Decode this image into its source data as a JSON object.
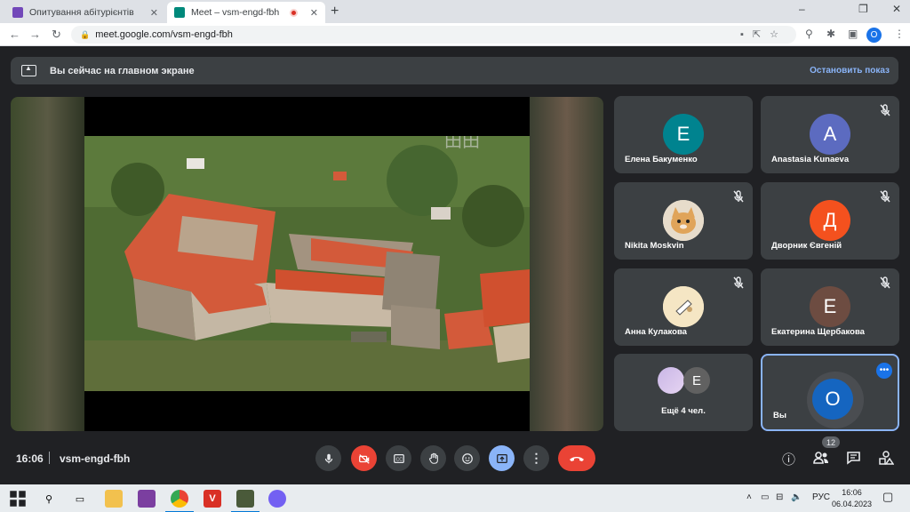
{
  "browser": {
    "tabs": [
      {
        "title": "Опитування абітурієнтів",
        "favicon_color": "#7248b9"
      },
      {
        "title": "Meet – vsm-engd-fbh",
        "favicon_color": "#00897b"
      }
    ],
    "new_tab": "+",
    "window_controls": {
      "minimize": "–",
      "maximize": "❐",
      "close": "✕"
    },
    "address": "meet.google.com/vsm-engd-fbh",
    "profile_initial": "O"
  },
  "banner": {
    "text": "Вы сейчас на главном экране",
    "stop_label": "Остановить показ"
  },
  "participants": [
    {
      "name": "Елена Бакуменко",
      "initial": "Е",
      "color": "#00838f",
      "muted": false
    },
    {
      "name": "Anastasia Kunaeva",
      "initial": "A",
      "color": "#5c6bc0",
      "muted": true
    },
    {
      "name": "Nikita Moskvin",
      "initial": "",
      "color": "#e8e2d6",
      "muted": true
    },
    {
      "name": "Дворник Євгеній",
      "initial": "Д",
      "color": "#f4511e",
      "muted": true
    },
    {
      "name": "Анна Кулакова",
      "initial": "",
      "color": "#f3e3c0",
      "muted": true
    },
    {
      "name": "Екатерина Щербакова",
      "initial": "Е",
      "color": "#6d4c41",
      "muted": true
    },
    {
      "name": "Ещё 4 чел.",
      "initial": "Е",
      "color": "#616161",
      "muted": false
    },
    {
      "name": "Вы",
      "initial": "O",
      "color": "#1565c0",
      "muted": false
    }
  ],
  "bottom": {
    "time": "16:06",
    "meeting_code": "vsm-engd-fbh",
    "participant_count": "12"
  },
  "taskbar": {
    "lang": "РУС",
    "time": "16:06",
    "date": "06.04.2023"
  }
}
